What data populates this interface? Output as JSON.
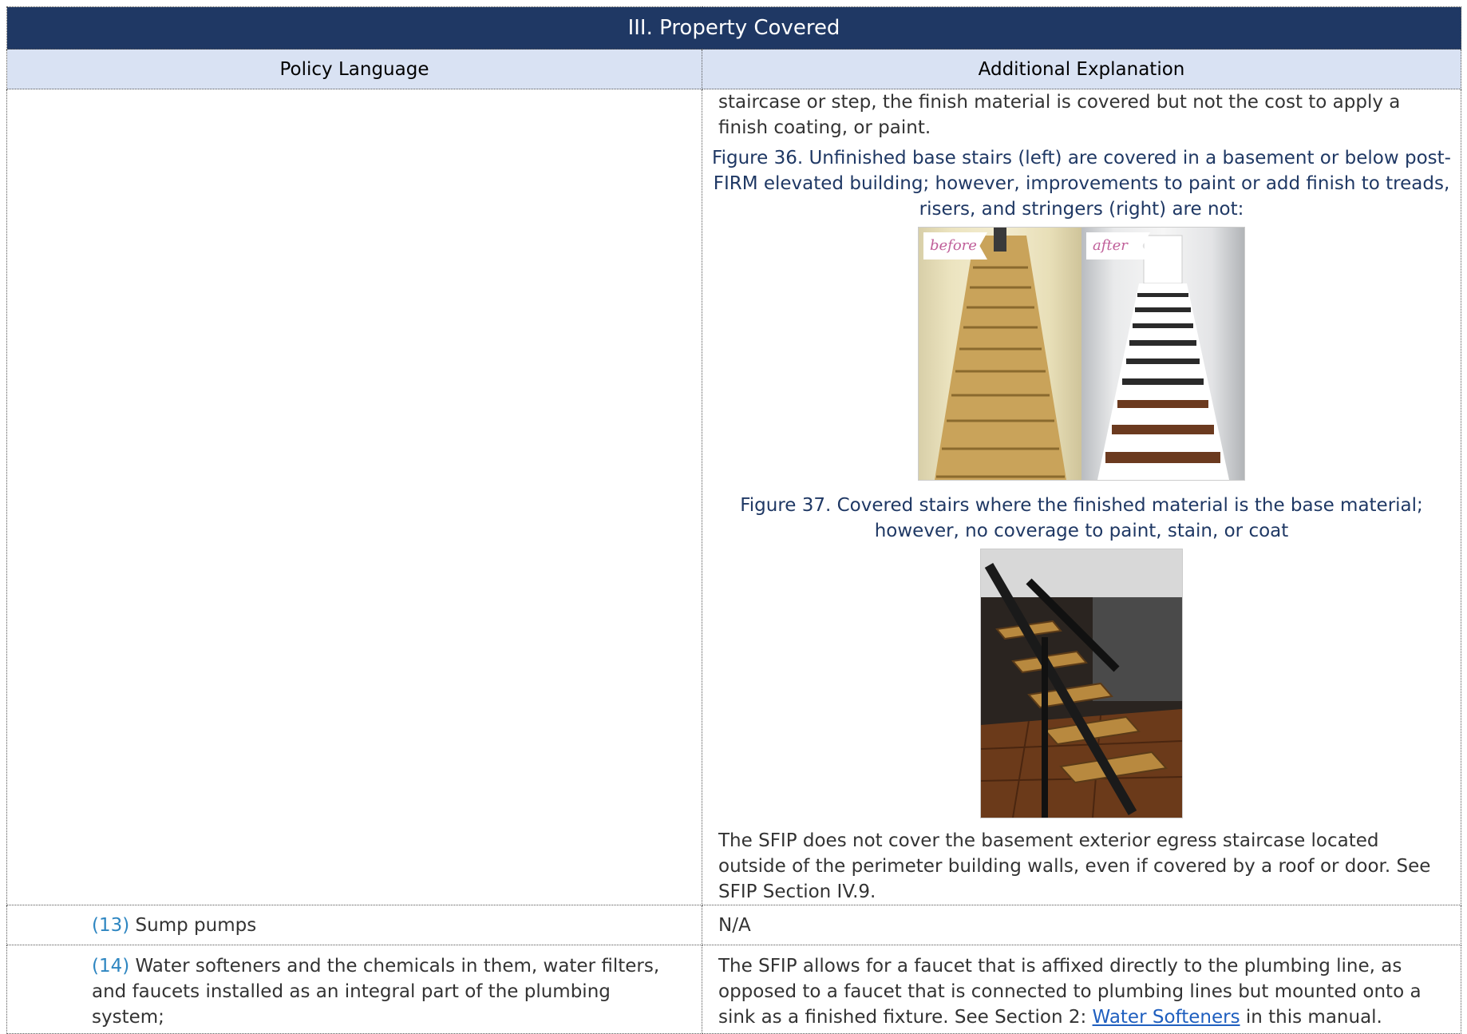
{
  "header": {
    "title": "III.  Property Covered",
    "col_left": "Policy Language",
    "col_right": "Additional Explanation"
  },
  "row1": {
    "intro_text": "staircase or step, the finish material is covered but not the cost to apply a finish coating, or paint.",
    "figure36_caption": "Figure 36. Unfinished base stairs (left) are covered in a basement or below post-FIRM elevated building; however, improvements to paint or add finish to treads, risers, and stringers (right) are not:",
    "figure36_label_before": "before",
    "figure36_label_after": "after",
    "figure37_caption": "Figure 37. Covered stairs where the finished material is the base material; however, no coverage to paint, stain, or coat",
    "closing_text": "The SFIP does not cover the basement exterior egress staircase located outside of the perimeter building walls, even if covered by a roof or door. See SFIP Section IV.9."
  },
  "row2": {
    "number": "(13)",
    "policy": "Sump pumps",
    "explanation": "N/A"
  },
  "row3": {
    "number": "(14)",
    "policy": "Water softeners and the chemicals in them, water filters, and faucets installed as an integral part of the plumbing system;",
    "explanation_before": "The SFIP allows for a faucet that is affixed directly to the plumbing line, as opposed to a faucet that is connected to plumbing lines but mounted onto a sink as a finished fixture. See Section 2: ",
    "explanation_link": "Water Softeners",
    "explanation_after": " in this manual."
  },
  "colors": {
    "title_bg": "#1f3864",
    "header_bg": "#d9e2f3",
    "caption": "#1f3864",
    "number": "#2e86c1",
    "link": "#1f5fbf"
  }
}
